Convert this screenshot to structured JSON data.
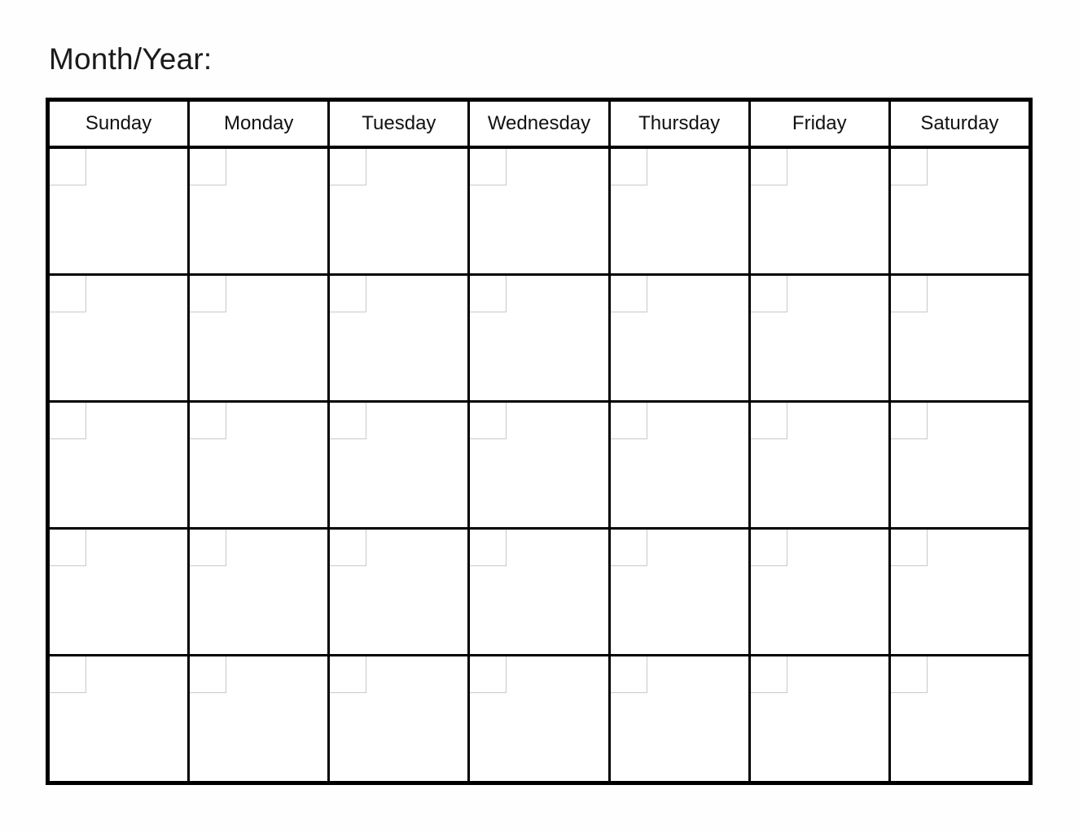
{
  "document": {
    "title_label": "Month/Year:",
    "background_color": "#fefefe",
    "border_color": "#000000",
    "date_box_border_color": "#c9c9c9",
    "text_color": "#111111"
  },
  "calendar": {
    "day_headers": [
      "Sunday",
      "Monday",
      "Tuesday",
      "Wednesday",
      "Thursday",
      "Friday",
      "Saturday"
    ],
    "week_rows": 5,
    "columns": 7,
    "cells": [
      [
        {
          "date": ""
        },
        {
          "date": ""
        },
        {
          "date": ""
        },
        {
          "date": ""
        },
        {
          "date": ""
        },
        {
          "date": ""
        },
        {
          "date": ""
        }
      ],
      [
        {
          "date": ""
        },
        {
          "date": ""
        },
        {
          "date": ""
        },
        {
          "date": ""
        },
        {
          "date": ""
        },
        {
          "date": ""
        },
        {
          "date": ""
        }
      ],
      [
        {
          "date": ""
        },
        {
          "date": ""
        },
        {
          "date": ""
        },
        {
          "date": ""
        },
        {
          "date": ""
        },
        {
          "date": ""
        },
        {
          "date": ""
        }
      ],
      [
        {
          "date": ""
        },
        {
          "date": ""
        },
        {
          "date": ""
        },
        {
          "date": ""
        },
        {
          "date": ""
        },
        {
          "date": ""
        },
        {
          "date": ""
        }
      ],
      [
        {
          "date": ""
        },
        {
          "date": ""
        },
        {
          "date": ""
        },
        {
          "date": ""
        },
        {
          "date": ""
        },
        {
          "date": ""
        },
        {
          "date": ""
        }
      ]
    ]
  }
}
